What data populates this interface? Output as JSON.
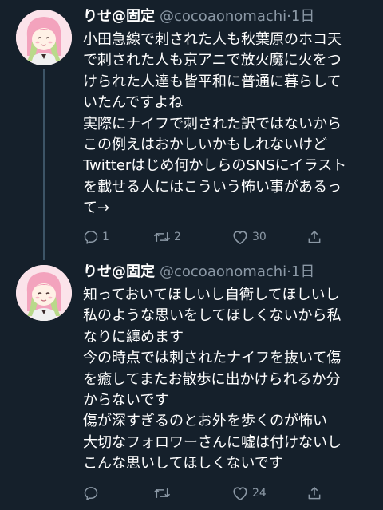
{
  "tweets": [
    {
      "name": "りせ@固定",
      "handle": "@cocoaonomachi",
      "time": "1日",
      "lines": [
        "小田急線で刺された人も秋葉原のホコ天",
        "で刺された人も京アニで放火魔に火をつ",
        "けられた人達も皆平和に普通に暮らして",
        "いたんですよね",
        "実際にナイフで刺された訳ではないから",
        "この例えはおかしいかもしれないけど",
        "Twitterはじめ何かしらのSNSにイラスト",
        "を載せる人にはこういう怖い事があるっ",
        "て→"
      ],
      "replies": "1",
      "retweets": "2",
      "likes": "30"
    },
    {
      "name": "りせ@固定",
      "handle": "@cocoaonomachi",
      "time": "1日",
      "lines": [
        "知っておいてほしいし自衛してほしいし",
        "私のような思いをしてほしくないから私",
        "なりに纏めます",
        "今の時点では刺されたナイフを抜いて傷",
        "を癒してまたお散歩に出かけられるか分",
        "からないです",
        "傷が深すぎるのとお外を歩くのが怖い",
        "大切なフォロワーさんに嘘は付けないし",
        "こんな思いしてほしくないです"
      ],
      "replies": "",
      "retweets": "",
      "likes": "24"
    }
  ],
  "icons": {
    "reply": "reply-icon",
    "retweet": "retweet-icon",
    "like": "heart-icon",
    "share": "share-icon"
  },
  "colors": {
    "background": "#15202b",
    "text": "#ffffff",
    "secondary": "#8b98a5",
    "thread_line": "#3d5466"
  }
}
